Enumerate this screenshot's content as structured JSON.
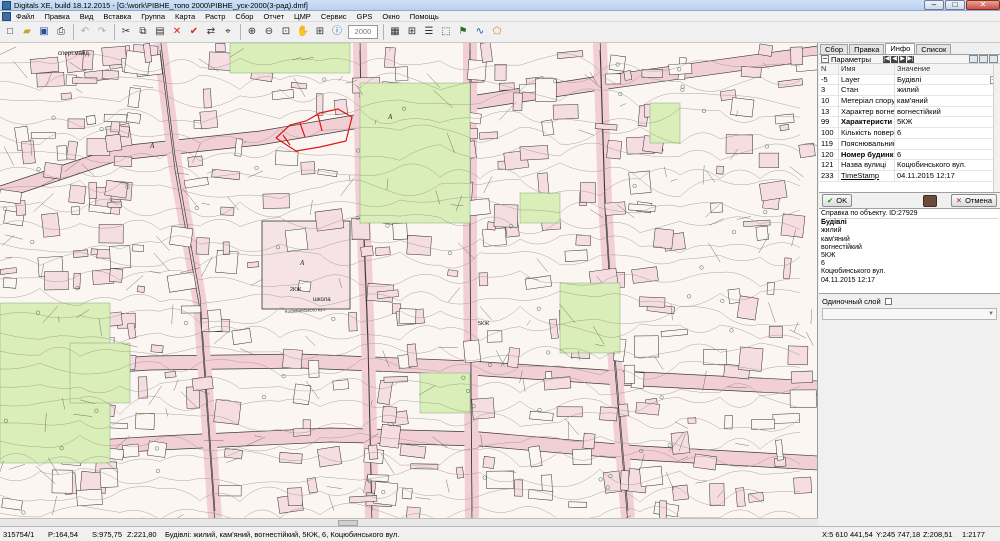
{
  "window": {
    "title": "Digitals XE, build 18.12.2015 - [G:\\work\\РІВНЕ_топо 2000\\РІВНЕ_уск-2000(3-рад).dmf]"
  },
  "menu": [
    "Файл",
    "Правка",
    "Вид",
    "Вставка",
    "Группа",
    "Карта",
    "Растр",
    "Сбор",
    "Отчет",
    "ЦМР",
    "Сервис",
    "GPS",
    "Окно",
    "Помощь"
  ],
  "toolbar": {
    "scale_placeholder": "2000",
    "icons": [
      "new-icon",
      "open-icon",
      "save-icon",
      "print-icon",
      "undo-icon",
      "redo-icon",
      "cut-icon",
      "copy-icon",
      "paste-icon",
      "delete-icon",
      "check-icon",
      "transform-icon",
      "snap-icon",
      "zoom-in-icon",
      "zoom-out-icon",
      "zoom-window-icon",
      "pan-icon",
      "zoom-all-icon",
      "info-icon",
      "table-icon",
      "grid-icon",
      "layers-icon",
      "select-icon",
      "flag-icon",
      "curve-icon",
      "polygon-icon"
    ]
  },
  "panel": {
    "tabs": [
      "Сбор",
      "Правка",
      "Инфо",
      "Список"
    ],
    "active_tab": "Инфо",
    "params_label": "Параметры",
    "columns": {
      "n": "N",
      "name": "Имя",
      "value": "Значение"
    },
    "rows": [
      {
        "n": "-5",
        "name": "Layer",
        "value": "Будівлі",
        "style": "",
        "has_dots": true
      },
      {
        "n": "3",
        "name": "Стан",
        "value": "жилий",
        "style": "",
        "has_dots": false
      },
      {
        "n": "10",
        "name": "Метеріал спору",
        "value": "кам'яний",
        "style": "",
        "has_dots": false
      },
      {
        "n": "13",
        "name": "Характер вогнест",
        "value": "вогнестійкий",
        "style": "",
        "has_dots": false
      },
      {
        "n": "99",
        "name": "Характеристи",
        "value": "5КЖ",
        "style": "bold",
        "has_dots": false
      },
      {
        "n": "100",
        "name": "Кількість повер",
        "value": "6",
        "style": "",
        "has_dots": false
      },
      {
        "n": "119",
        "name": "Пояснювальний",
        "value": "",
        "style": "",
        "has_dots": false
      },
      {
        "n": "120",
        "name": "Номер будинк",
        "value": "6",
        "style": "bold",
        "has_dots": false
      },
      {
        "n": "121",
        "name": "Назва вулиці",
        "value": "Коцюбинського вул.",
        "style": "",
        "has_dots": false
      },
      {
        "n": "233",
        "name": "TimeStamp",
        "value": "04.11.2015 12:17",
        "style": "link",
        "has_dots": false
      }
    ],
    "ok_label": "OK",
    "cancel_label": "Отмена",
    "info": {
      "header": "Справка по объекту. ID:27929",
      "title": "Будівлі",
      "lines": [
        "жилий",
        "кам'яний",
        "вогнестійкий",
        "5КЖ",
        "6",
        "Коцюбинського вул.",
        "04.11.2015 12:17"
      ]
    },
    "single_layer_label": "Одиночный слой"
  },
  "map": {
    "labels": [
      {
        "text": "спорт.майд.",
        "kind": "label"
      },
      {
        "text": "школа",
        "kind": "label"
      },
      {
        "text": "А",
        "kind": "label"
      },
      {
        "text": "А",
        "kind": "label"
      },
      {
        "text": "А",
        "kind": "label"
      },
      {
        "text": "5КЖ",
        "kind": "label"
      },
      {
        "text": "2КЖ",
        "kind": "label"
      },
      {
        "text": "Коцюбинського вул.",
        "kind": "label"
      }
    ]
  },
  "status": {
    "sheet": "315754/1",
    "p": "P:164,54",
    "s": "S:975,75",
    "z": "Z:221,80",
    "desc": "Будівлі: жилий, кам'яний, вогнестійкий, 5КЖ, 6, Коцюбинського вул.",
    "x": "X:5 610 441,54",
    "y": "Y:245 747,18",
    "zoom": "Z:208,51",
    "scale": "1:2177"
  }
}
